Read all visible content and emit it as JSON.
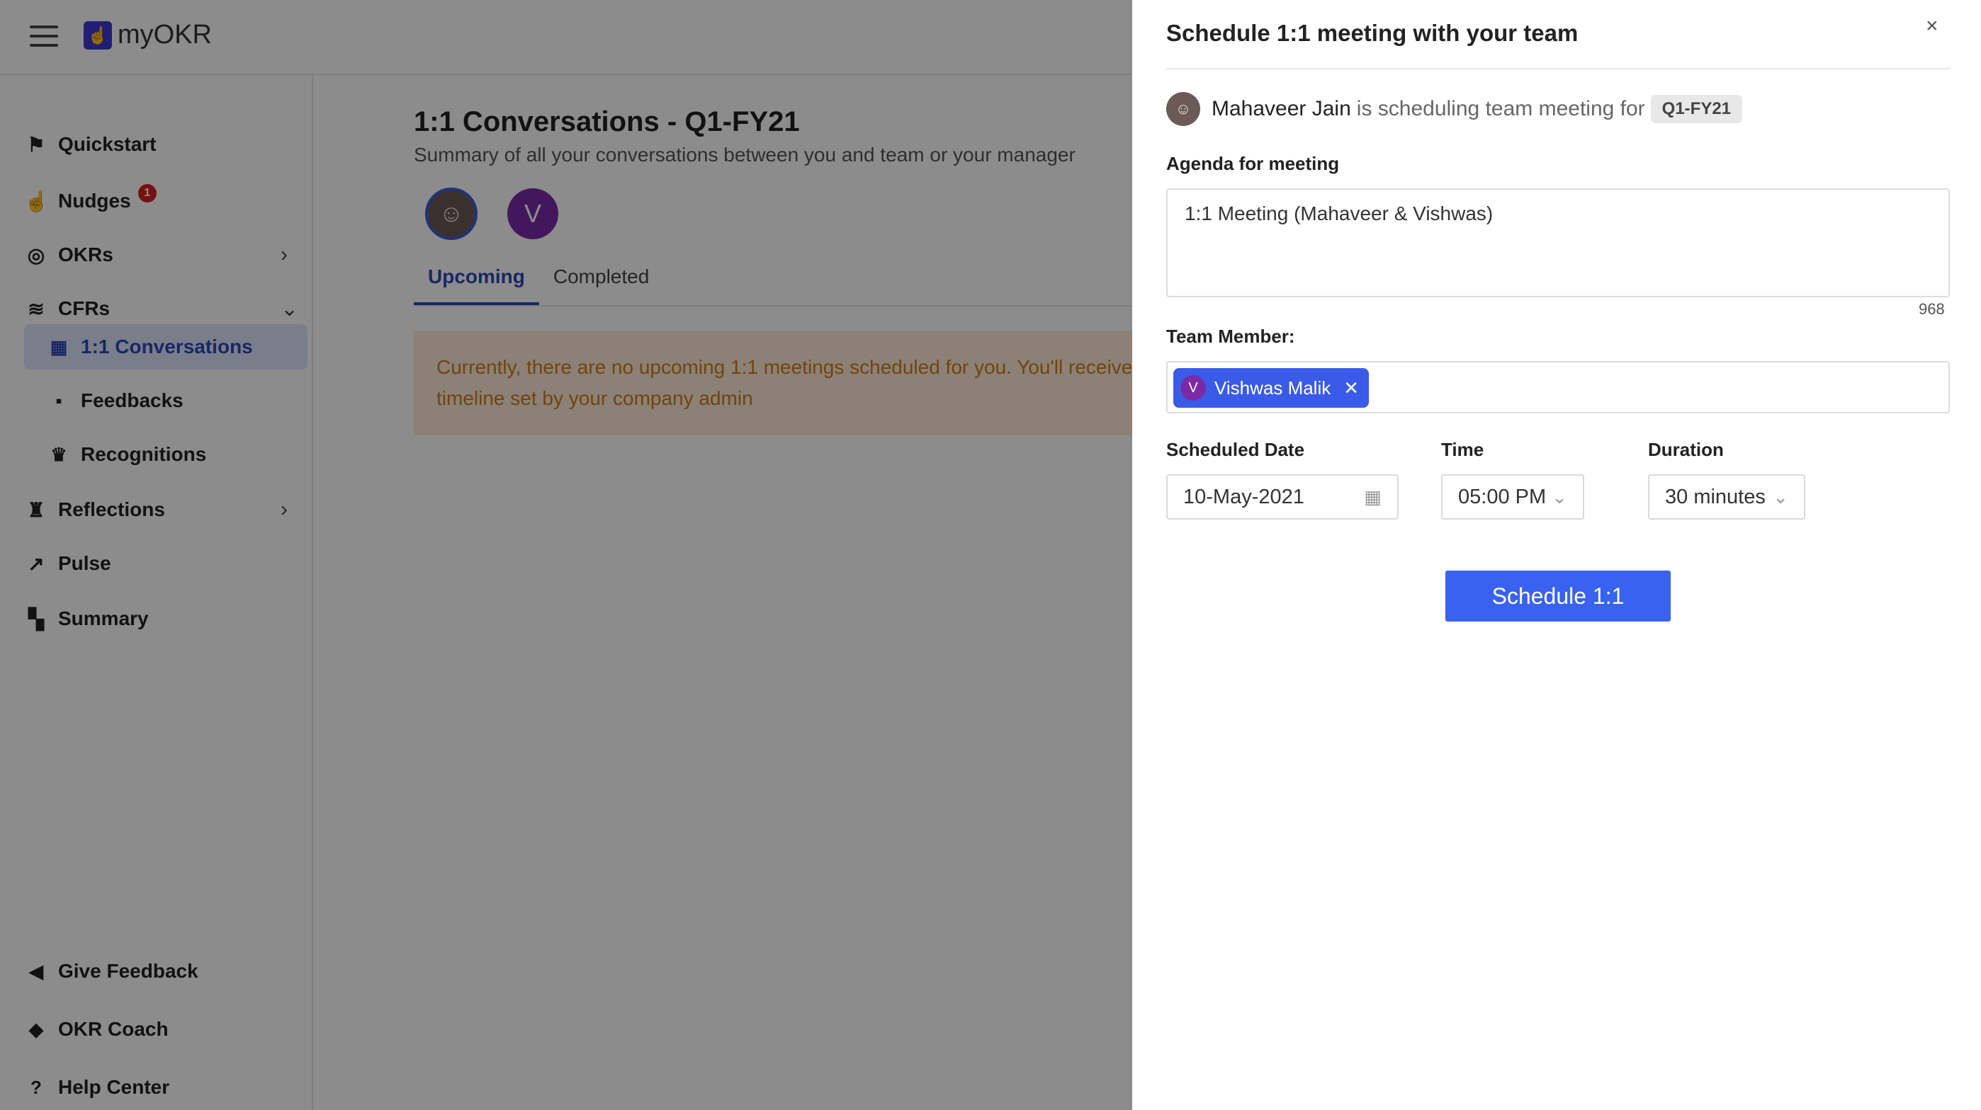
{
  "app": {
    "logo_text": "myOKR"
  },
  "sidebar": {
    "items": [
      {
        "label": "Quickstart",
        "icon": "quickstart-icon"
      },
      {
        "label": "Nudges",
        "icon": "hand-icon",
        "badge": "1"
      },
      {
        "label": "OKRs",
        "icon": "target-icon"
      },
      {
        "label": "CFRs",
        "icon": "wave-icon"
      },
      {
        "label": "1:1 Conversations",
        "icon": "calendar-icon",
        "active": true
      },
      {
        "label": "Feedbacks",
        "icon": "feedback-icon"
      },
      {
        "label": "Recognitions",
        "icon": "trophy-icon"
      },
      {
        "label": "Reflections",
        "icon": "torch-icon"
      },
      {
        "label": "Pulse",
        "icon": "trend-icon"
      },
      {
        "label": "Summary",
        "icon": "dashboard-icon"
      }
    ],
    "bottom": [
      {
        "label": "Give Feedback",
        "icon": "megaphone-icon"
      },
      {
        "label": "OKR Coach",
        "icon": "graduation-cap-icon"
      },
      {
        "label": "Help Center",
        "icon": "help-icon"
      }
    ]
  },
  "main": {
    "title": "1:1 Conversations - Q1-FY21",
    "subtitle": "Summary of all your conversations between you and team or your manager",
    "avatar_letter": "V",
    "tabs": [
      {
        "label": "Upcoming",
        "active": true
      },
      {
        "label": "Completed",
        "active": false
      }
    ],
    "alert_line1": "Currently, there are no upcoming 1:1 meetings scheduled for you. You'll receive",
    "alert_line2": "timeline set by your company admin"
  },
  "drawer": {
    "title": "Schedule 1:1 meeting with your team",
    "close_symbol": "×",
    "scheduler_name": "Mahaveer Jain",
    "scheduler_text": "is scheduling team meeting for",
    "quarter": "Q1-FY21",
    "agenda_label": "Agenda for meeting",
    "agenda_value": "1:1 Meeting (Mahaveer & Vishwas)",
    "agenda_counter": "968",
    "team_member_label": "Team Member:",
    "member": {
      "initial": "V",
      "name": "Vishwas Malik"
    },
    "date_label": "Scheduled Date",
    "date_value": "10-May-2021",
    "time_label": "Time",
    "time_value": "05:00 PM",
    "duration_label": "Duration",
    "duration_value": "30 minutes",
    "submit_label": "Schedule 1:1"
  },
  "colors": {
    "primary": "#3a62f0",
    "chip": "#3a5be8",
    "avatar_purple": "#7b2aa6",
    "alert_bg": "#fdebd7",
    "alert_text": "#cf7a1a",
    "badge": "#d32020"
  }
}
